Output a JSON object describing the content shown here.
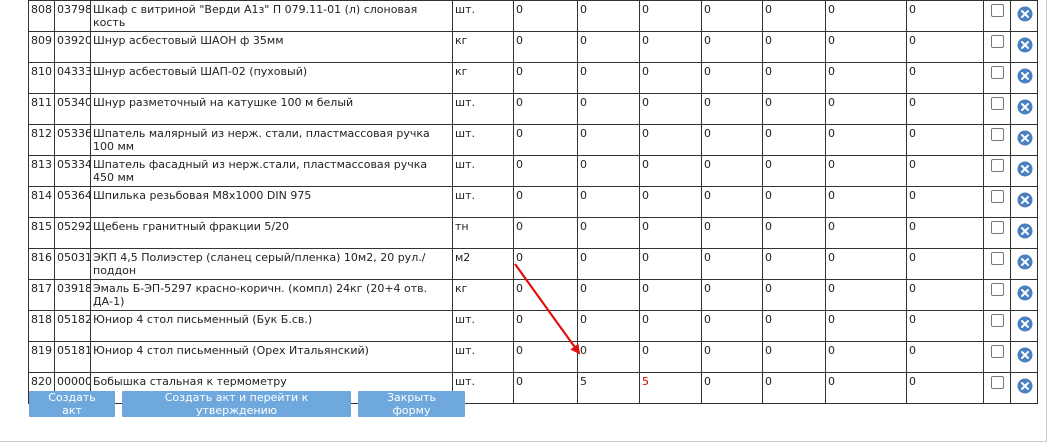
{
  "table": {
    "rows": [
      {
        "n": "808",
        "code": "03798",
        "name": "Шкаф с витриной \"Верди А1з\" П 079.11-01 (л) слоновая кость",
        "unit": "шт.",
        "v": [
          "0",
          "0",
          "0",
          "0",
          "0",
          "0",
          "0"
        ]
      },
      {
        "n": "809",
        "code": "03920",
        "name": "Шнур асбестовый ШАОН ф 35мм",
        "unit": "кг",
        "v": [
          "0",
          "0",
          "0",
          "0",
          "0",
          "0",
          "0"
        ]
      },
      {
        "n": "810",
        "code": "04333",
        "name": "Шнур асбестовый ШАП-02 (пуховый)",
        "unit": "кг",
        "v": [
          "0",
          "0",
          "0",
          "0",
          "0",
          "0",
          "0"
        ]
      },
      {
        "n": "811",
        "code": "05340",
        "name": "Шнур разметочный на катушке 100 м белый",
        "unit": "шт.",
        "v": [
          "0",
          "0",
          "0",
          "0",
          "0",
          "0",
          "0"
        ]
      },
      {
        "n": "812",
        "code": "05336",
        "name": "Шпатель малярный из нерж. стали, пластмассовая ручка 100 мм",
        "unit": "шт.",
        "v": [
          "0",
          "0",
          "0",
          "0",
          "0",
          "0",
          "0"
        ]
      },
      {
        "n": "813",
        "code": "05334",
        "name": "Шпатель фасадный из нерж.стали, пластмассовая ручка 450 мм",
        "unit": "шт.",
        "v": [
          "0",
          "0",
          "0",
          "0",
          "0",
          "0",
          "0"
        ]
      },
      {
        "n": "814",
        "code": "05364",
        "name": "Шпилька резьбовая М8х1000 DIN 975",
        "unit": "шт.",
        "v": [
          "0",
          "0",
          "0",
          "0",
          "0",
          "0",
          "0"
        ]
      },
      {
        "n": "815",
        "code": "05292",
        "name": "Щебень гранитный фракции 5/20",
        "unit": "тн",
        "v": [
          "0",
          "0",
          "0",
          "0",
          "0",
          "0",
          "0"
        ]
      },
      {
        "n": "816",
        "code": "05031",
        "name": "ЭКП 4,5 Полиэстер (сланец серый/пленка) 10м2, 20 рул./поддон",
        "unit": "м2",
        "v": [
          "0",
          "0",
          "0",
          "0",
          "0",
          "0",
          "0"
        ]
      },
      {
        "n": "817",
        "code": "03918",
        "name": "Эмаль Б-ЭП-5297 красно-коричн. (компл) 24кг (20+4 отв. ДА-1)",
        "unit": "кг",
        "v": [
          "0",
          "0",
          "0",
          "0",
          "0",
          "0",
          "0"
        ]
      },
      {
        "n": "818",
        "code": "05182",
        "name": "Юниор 4 стол письменный (Бук Б.св.)",
        "unit": "шт.",
        "v": [
          "0",
          "0",
          "0",
          "0",
          "0",
          "0",
          "0"
        ]
      },
      {
        "n": "819",
        "code": "05181",
        "name": "Юниор 4 стол письменный (Орех Итальянский)",
        "unit": "шт.",
        "v": [
          "0",
          "0",
          "0",
          "0",
          "0",
          "0",
          "0"
        ]
      },
      {
        "n": "820",
        "code": "00000",
        "name": "Бобышка стальная к термометру",
        "unit": "шт.",
        "v": [
          "0",
          "5",
          "5",
          "0",
          "0",
          "0",
          "0"
        ]
      }
    ]
  },
  "buttons": {
    "create": "Создать акт",
    "create_approve": "Создать акт и перейти к утверждению",
    "close": "Закрыть форму"
  },
  "colors": {
    "button": "#6fa8dc",
    "delete_icon": "#4a7fc1",
    "highlight_value": "#e00000",
    "arrow": "#e01010"
  },
  "icons": {
    "delete": "close-circle-icon"
  }
}
